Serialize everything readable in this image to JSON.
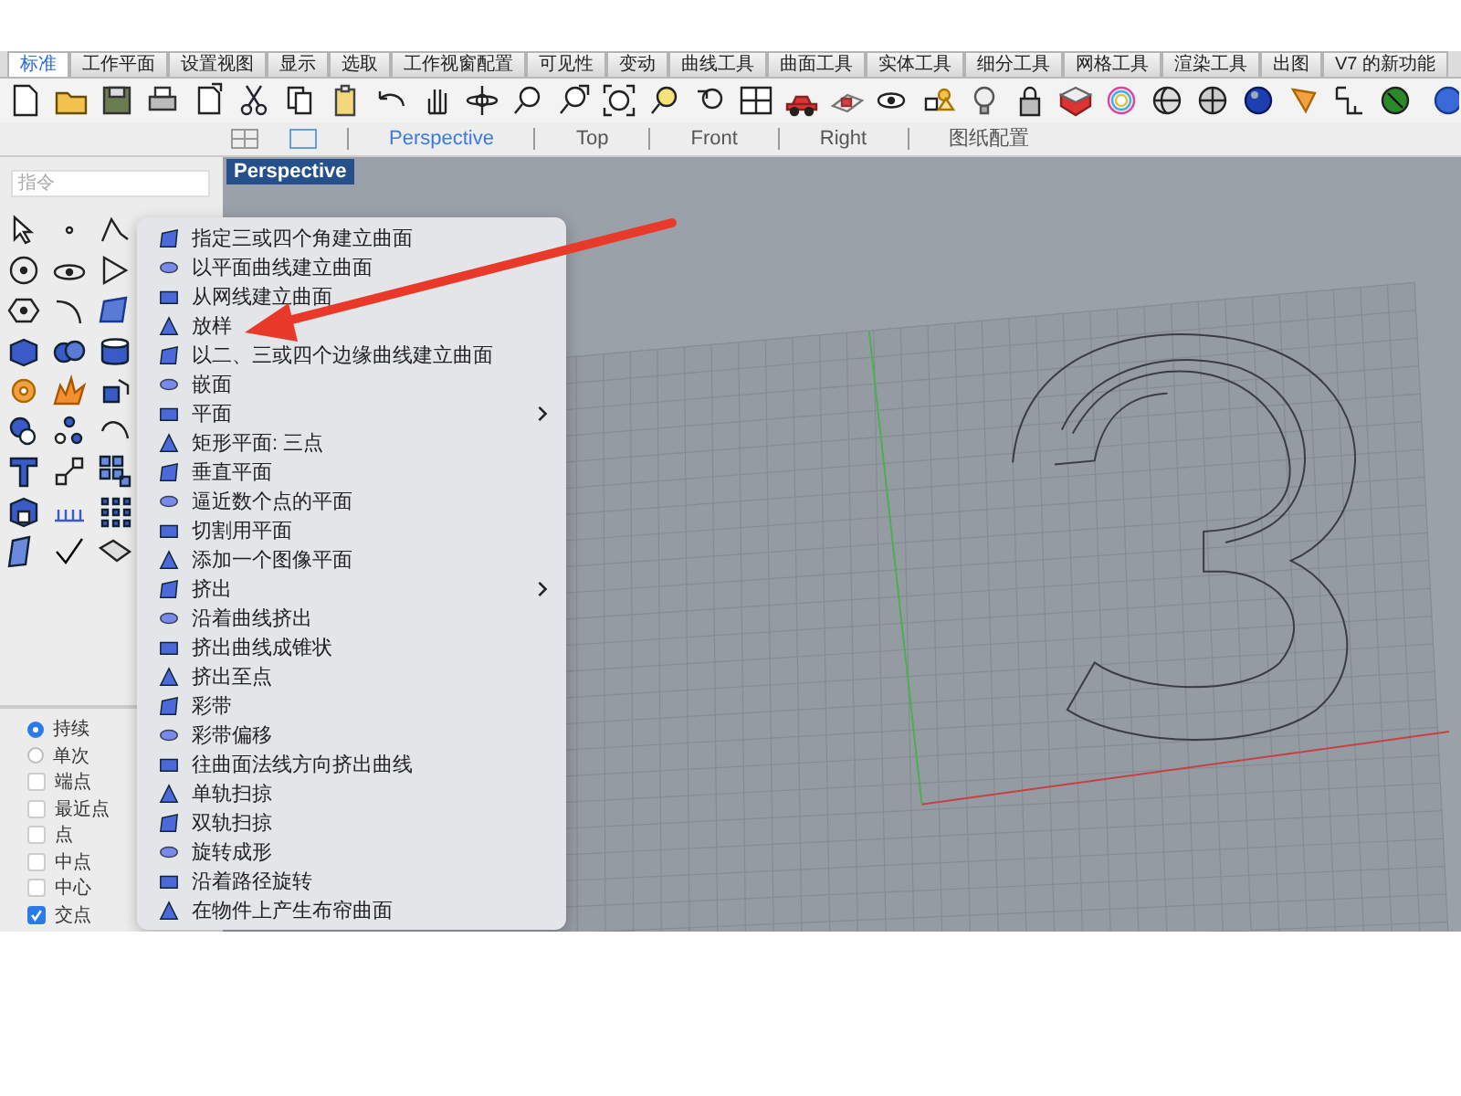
{
  "tabs": [
    {
      "label": "标准",
      "selected": true
    },
    {
      "label": "工作平面",
      "selected": false
    },
    {
      "label": "设置视图",
      "selected": false
    },
    {
      "label": "显示",
      "selected": false
    },
    {
      "label": "选取",
      "selected": false
    },
    {
      "label": "工作视窗配置",
      "selected": false
    },
    {
      "label": "可见性",
      "selected": false
    },
    {
      "label": "变动",
      "selected": false
    },
    {
      "label": "曲线工具",
      "selected": false
    },
    {
      "label": "曲面工具",
      "selected": false
    },
    {
      "label": "实体工具",
      "selected": false
    },
    {
      "label": "细分工具",
      "selected": false
    },
    {
      "label": "网格工具",
      "selected": false
    },
    {
      "label": "渲染工具",
      "selected": false
    },
    {
      "label": "出图",
      "selected": false
    },
    {
      "label": "V7 的新功能",
      "selected": false
    }
  ],
  "view_tabs": [
    {
      "label": "Perspective",
      "selected": true
    },
    {
      "label": "Top",
      "selected": false
    },
    {
      "label": "Front",
      "selected": false
    },
    {
      "label": "Right",
      "selected": false
    },
    {
      "label": "图纸配置",
      "selected": false
    }
  ],
  "command_field": {
    "placeholder": "指令"
  },
  "viewport": {
    "title": "Perspective"
  },
  "context_menu": {
    "items": [
      {
        "label": "指定三或四个角建立曲面",
        "submenu": false
      },
      {
        "label": "以平面曲线建立曲面",
        "submenu": false
      },
      {
        "label": "从网线建立曲面",
        "submenu": false
      },
      {
        "label": "放样",
        "submenu": false
      },
      {
        "label": "以二、三或四个边缘曲线建立曲面",
        "submenu": false
      },
      {
        "label": "嵌面",
        "submenu": false
      },
      {
        "label": "平面",
        "submenu": true
      },
      {
        "label": "矩形平面: 三点",
        "submenu": false
      },
      {
        "label": "垂直平面",
        "submenu": false
      },
      {
        "label": "逼近数个点的平面",
        "submenu": false
      },
      {
        "label": "切割用平面",
        "submenu": false
      },
      {
        "label": "添加一个图像平面",
        "submenu": false
      },
      {
        "label": "挤出",
        "submenu": true
      },
      {
        "label": "沿着曲线挤出",
        "submenu": false
      },
      {
        "label": "挤出曲线成锥状",
        "submenu": false
      },
      {
        "label": "挤出至点",
        "submenu": false
      },
      {
        "label": "彩带",
        "submenu": false
      },
      {
        "label": "彩带偏移",
        "submenu": false
      },
      {
        "label": "往曲面法线方向挤出曲线",
        "submenu": false
      },
      {
        "label": "单轨扫掠",
        "submenu": false
      },
      {
        "label": "双轨扫掠",
        "submenu": false
      },
      {
        "label": "旋转成形",
        "submenu": false
      },
      {
        "label": "沿着路径旋转",
        "submenu": false
      },
      {
        "label": "在物件上产生布帘曲面",
        "submenu": false
      }
    ]
  },
  "osnap": [
    {
      "kind": "radio",
      "label": "持续",
      "selected": true
    },
    {
      "kind": "radio",
      "label": "单次",
      "selected": false
    },
    {
      "kind": "checkbox",
      "label": "端点",
      "checked": false
    },
    {
      "kind": "checkbox",
      "label": "最近点",
      "checked": false
    },
    {
      "kind": "checkbox",
      "label": "点",
      "checked": false
    },
    {
      "kind": "checkbox",
      "label": "中点",
      "checked": false
    },
    {
      "kind": "checkbox",
      "label": "中心",
      "checked": false
    },
    {
      "kind": "checkbox",
      "label": "交点",
      "checked": true
    }
  ]
}
